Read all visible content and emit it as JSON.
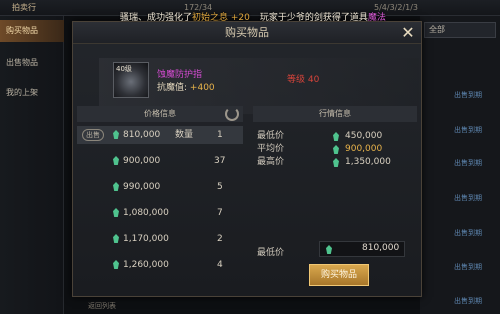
{
  "background": {
    "tabs": [
      "拍卖行"
    ],
    "top_counters": [
      "172/34",
      "5/4/3/2/1/3"
    ],
    "sidebar": [
      "购买物品",
      "出售物品",
      "我的上架"
    ],
    "right_select": "全部",
    "right_rows": [
      "出售到期",
      "出售到期",
      "出售到期",
      "出售到期",
      "出售到期",
      "出售到期",
      "出售到期"
    ],
    "bottom_button": "返回列表"
  },
  "notice": {
    "part1": "骚瑞、成功强化了",
    "highlight1": "初始之息 +20",
    "part2": "玩家于少爷的剑获得了道具",
    "highlight2": "魔法"
  },
  "modal": {
    "title": "购买物品",
    "close_icon": "close-x-icon"
  },
  "item": {
    "level": "40级",
    "name": "蚀魔防护指",
    "stat_label": "抗魔值:",
    "stat_value": "+400",
    "requirement": "等级 40"
  },
  "price_info": {
    "header": "价格信息",
    "qty_label": "数量",
    "out_tag": "出售",
    "rows": [
      {
        "price": "810,000",
        "qty": "1"
      },
      {
        "price": "900,000",
        "qty": "37"
      },
      {
        "price": "990,000",
        "qty": "5"
      },
      {
        "price": "1,080,000",
        "qty": "7"
      },
      {
        "price": "1,170,000",
        "qty": "2"
      },
      {
        "price": "1,260,000",
        "qty": "4"
      }
    ]
  },
  "market_info": {
    "header": "行情信息",
    "rows": [
      {
        "label": "最低价",
        "value": "450,000",
        "color": "#d9d1c1"
      },
      {
        "label": "平均价",
        "value": "900,000",
        "color": "#e7b34b"
      },
      {
        "label": "最高价",
        "value": "1,350,000",
        "color": "#d9d1c1"
      }
    ],
    "min_price_label": "最低价",
    "min_price_value": "810,000",
    "buy_button": "购买物品"
  },
  "colors": {
    "accent_gold": "#d9a84e",
    "gem_green": "#4fc38e",
    "item_purple": "#d34bd0",
    "warning_red": "#d6443b"
  }
}
